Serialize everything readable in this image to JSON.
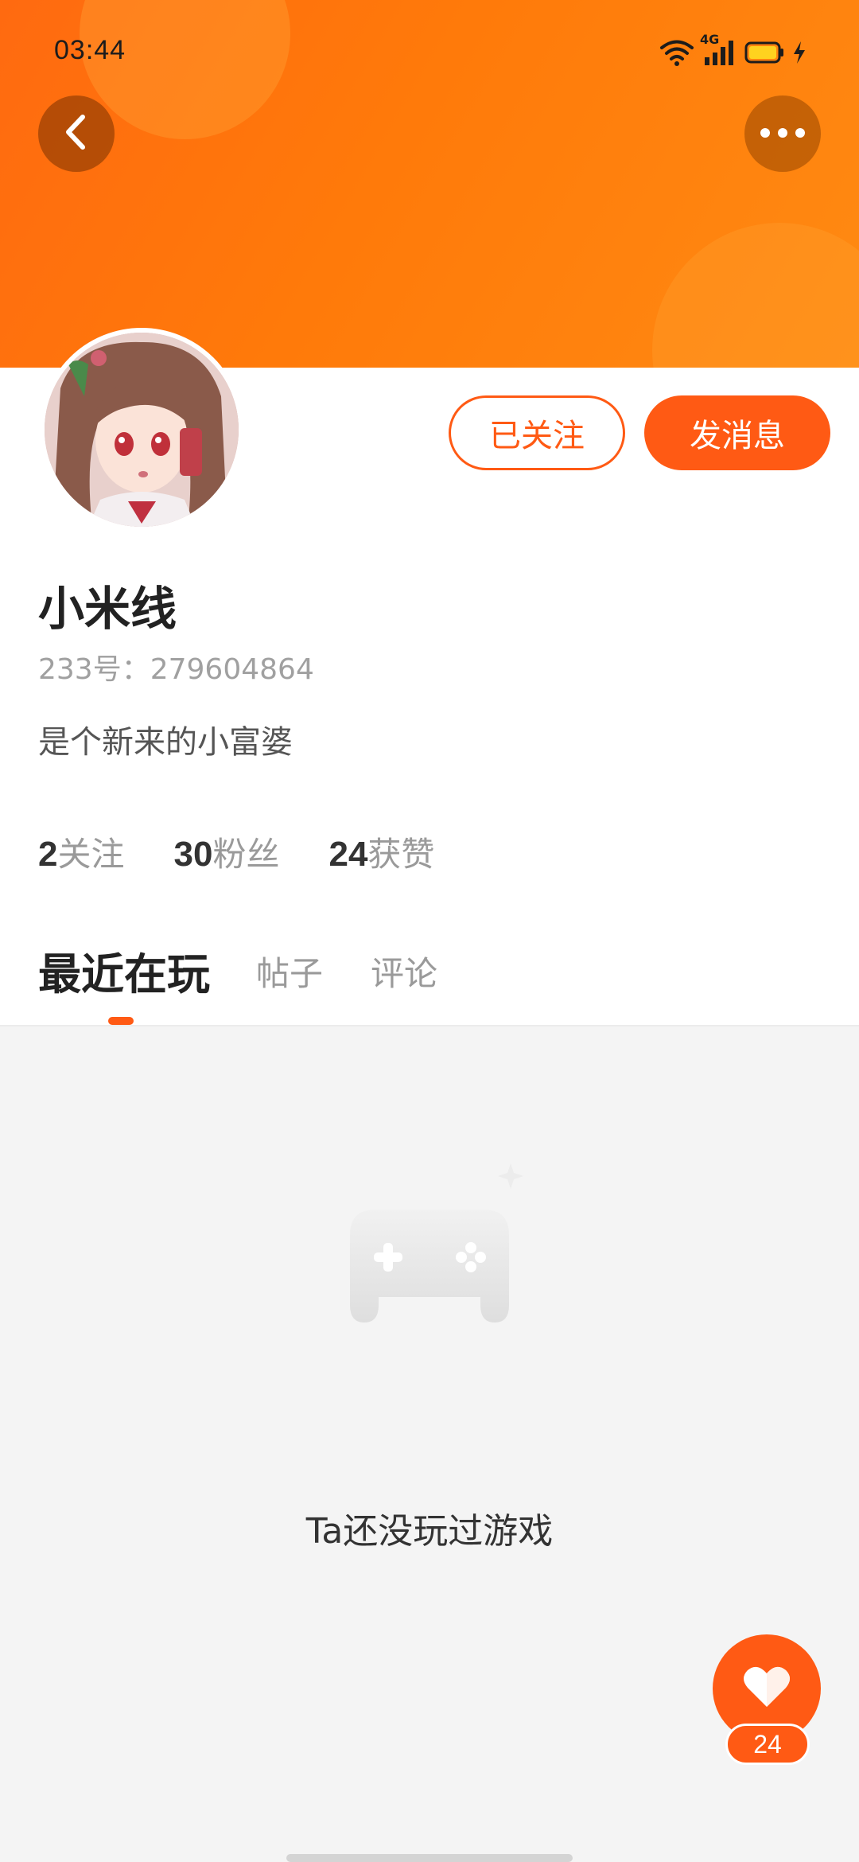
{
  "status_bar": {
    "time": "03:44",
    "network": "4G",
    "icons": [
      "wifi-icon",
      "signal-icon",
      "battery-icon",
      "charging-icon"
    ]
  },
  "header": {
    "back_icon": "chevron-left-icon",
    "more_icon": "more-dots-icon"
  },
  "profile": {
    "follow_label": "已关注",
    "message_label": "发消息",
    "username": "小米线",
    "user_id": "233号：279604864",
    "bio": "是个新来的小富婆"
  },
  "stats": [
    {
      "num": "2",
      "label": "关注"
    },
    {
      "num": "30",
      "label": "粉丝"
    },
    {
      "num": "24",
      "label": "获赞"
    }
  ],
  "tabs": [
    {
      "label": "最近在玩",
      "active": true
    },
    {
      "label": "帖子",
      "active": false
    },
    {
      "label": "评论",
      "active": false
    }
  ],
  "empty_state": {
    "icon": "gamepad-icon",
    "text": "Ta还没玩过游戏"
  },
  "like": {
    "icon": "heart-icon",
    "count": "24"
  },
  "colors": {
    "accent": "#ff5a14",
    "banner": "#ff7a0a",
    "background": "#f4f4f4"
  }
}
